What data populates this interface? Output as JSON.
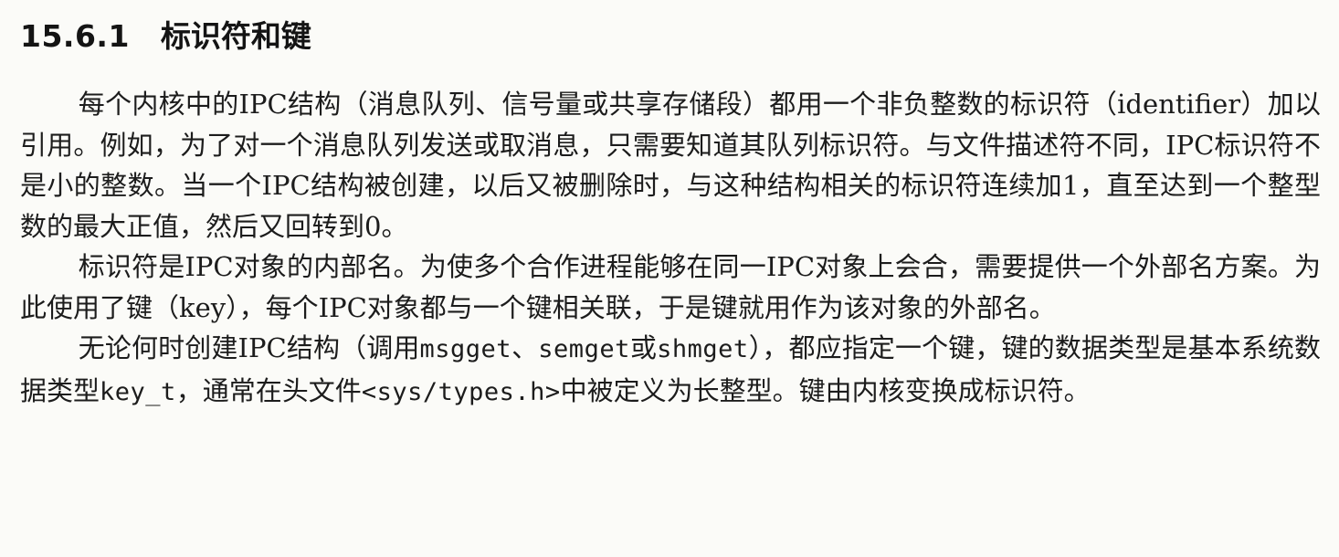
{
  "section": {
    "number": "15.6.1",
    "title": "标识符和键"
  },
  "paragraphs": [
    {
      "lines": [
        "每个内核中的IPC结构（消息队列、信号量或共享存储段）都用一个非负整数的标识符",
        "（identifier）加以引用。例如，为了对一个消息队列发送或取消息，只需要知道其队列标识符。",
        "与文件描述符不同，IPC标识符不是小的整数。当一个IPC结构被创建，以后又被删除时，与这",
        "种结构相关的标识符连续加1，直至达到一个整型数的最大正值，然后又回转到0。"
      ]
    },
    {
      "lines": [
        "标识符是IPC对象的内部名。为使多个合作进程能够在同一IPC对象上会合，需要提供一个",
        "外部名方案。为此使用了键（key），每个IPC对象都与一个键相关联，于是键就用作为该对象",
        "的外部名。"
      ]
    },
    {
      "segments": [
        {
          "text": "无论何时创建IPC结构（调用",
          "mono": false
        },
        {
          "text": "msgget",
          "mono": true
        },
        {
          "text": "、",
          "mono": false
        },
        {
          "text": "semget",
          "mono": true
        },
        {
          "text": "或",
          "mono": false
        },
        {
          "text": "shmget",
          "mono": true
        },
        {
          "text": "），都应指定一个键，键的数据类型是基本系统数据类型",
          "mono": false
        },
        {
          "text": "key_t",
          "mono": true
        },
        {
          "text": "，通常在头文件",
          "mono": false
        },
        {
          "text": "<sys/types.h>",
          "mono": true
        },
        {
          "text": "中被定义为长整型。键由内核变换成标识符。",
          "mono": false
        }
      ]
    }
  ]
}
